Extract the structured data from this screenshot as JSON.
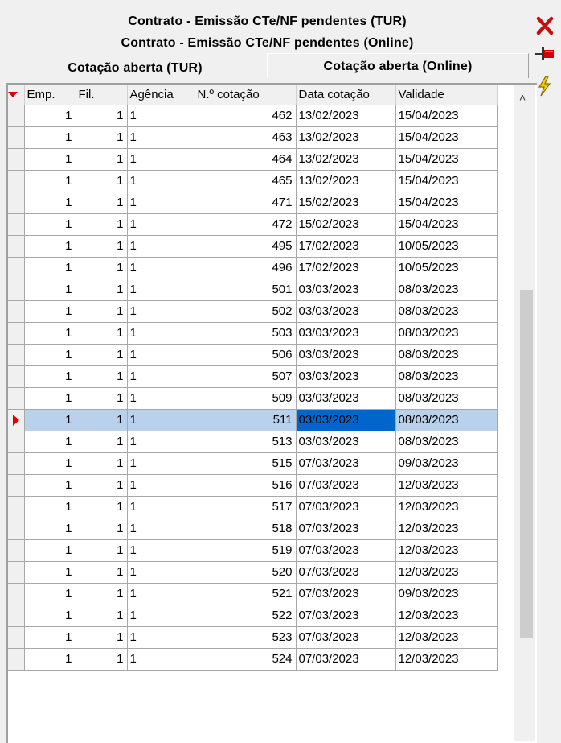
{
  "tabs": [
    {
      "label": "Contrato - Emissão CTe/NF pendentes (TUR)"
    },
    {
      "label": "Contrato - Emissão CTe/NF pendentes (Online)"
    },
    {
      "label": "Cotação aberta (TUR)"
    },
    {
      "label": "Cotação aberta (Online)",
      "active": true
    }
  ],
  "toolbar": {
    "close_icon": "close-icon",
    "pin_icon": "pin-icon",
    "bolt_icon": "lightning-icon"
  },
  "grid": {
    "columns": [
      "Emp.",
      "Fil.",
      "Agência",
      "N.º cotação",
      "Data cotação",
      "Validade"
    ],
    "selected_row": 14,
    "rows": [
      {
        "emp": "1",
        "fil": "1",
        "agencia": "1",
        "cotacao": "462",
        "data": "13/02/2023",
        "validade": "15/04/2023"
      },
      {
        "emp": "1",
        "fil": "1",
        "agencia": "1",
        "cotacao": "463",
        "data": "13/02/2023",
        "validade": "15/04/2023"
      },
      {
        "emp": "1",
        "fil": "1",
        "agencia": "1",
        "cotacao": "464",
        "data": "13/02/2023",
        "validade": "15/04/2023"
      },
      {
        "emp": "1",
        "fil": "1",
        "agencia": "1",
        "cotacao": "465",
        "data": "13/02/2023",
        "validade": "15/04/2023"
      },
      {
        "emp": "1",
        "fil": "1",
        "agencia": "1",
        "cotacao": "471",
        "data": "15/02/2023",
        "validade": "15/04/2023"
      },
      {
        "emp": "1",
        "fil": "1",
        "agencia": "1",
        "cotacao": "472",
        "data": "15/02/2023",
        "validade": "15/04/2023"
      },
      {
        "emp": "1",
        "fil": "1",
        "agencia": "1",
        "cotacao": "495",
        "data": "17/02/2023",
        "validade": "10/05/2023"
      },
      {
        "emp": "1",
        "fil": "1",
        "agencia": "1",
        "cotacao": "496",
        "data": "17/02/2023",
        "validade": "10/05/2023"
      },
      {
        "emp": "1",
        "fil": "1",
        "agencia": "1",
        "cotacao": "501",
        "data": "03/03/2023",
        "validade": "08/03/2023"
      },
      {
        "emp": "1",
        "fil": "1",
        "agencia": "1",
        "cotacao": "502",
        "data": "03/03/2023",
        "validade": "08/03/2023"
      },
      {
        "emp": "1",
        "fil": "1",
        "agencia": "1",
        "cotacao": "503",
        "data": "03/03/2023",
        "validade": "08/03/2023"
      },
      {
        "emp": "1",
        "fil": "1",
        "agencia": "1",
        "cotacao": "506",
        "data": "03/03/2023",
        "validade": "08/03/2023"
      },
      {
        "emp": "1",
        "fil": "1",
        "agencia": "1",
        "cotacao": "507",
        "data": "03/03/2023",
        "validade": "08/03/2023"
      },
      {
        "emp": "1",
        "fil": "1",
        "agencia": "1",
        "cotacao": "509",
        "data": "03/03/2023",
        "validade": "08/03/2023"
      },
      {
        "emp": "1",
        "fil": "1",
        "agencia": "1",
        "cotacao": "511",
        "data": "03/03/2023",
        "validade": "08/03/2023"
      },
      {
        "emp": "1",
        "fil": "1",
        "agencia": "1",
        "cotacao": "513",
        "data": "03/03/2023",
        "validade": "08/03/2023"
      },
      {
        "emp": "1",
        "fil": "1",
        "agencia": "1",
        "cotacao": "515",
        "data": "07/03/2023",
        "validade": "09/03/2023"
      },
      {
        "emp": "1",
        "fil": "1",
        "agencia": "1",
        "cotacao": "516",
        "data": "07/03/2023",
        "validade": "12/03/2023"
      },
      {
        "emp": "1",
        "fil": "1",
        "agencia": "1",
        "cotacao": "517",
        "data": "07/03/2023",
        "validade": "12/03/2023"
      },
      {
        "emp": "1",
        "fil": "1",
        "agencia": "1",
        "cotacao": "518",
        "data": "07/03/2023",
        "validade": "12/03/2023"
      },
      {
        "emp": "1",
        "fil": "1",
        "agencia": "1",
        "cotacao": "519",
        "data": "07/03/2023",
        "validade": "12/03/2023"
      },
      {
        "emp": "1",
        "fil": "1",
        "agencia": "1",
        "cotacao": "520",
        "data": "07/03/2023",
        "validade": "12/03/2023"
      },
      {
        "emp": "1",
        "fil": "1",
        "agencia": "1",
        "cotacao": "521",
        "data": "07/03/2023",
        "validade": "09/03/2023"
      },
      {
        "emp": "1",
        "fil": "1",
        "agencia": "1",
        "cotacao": "522",
        "data": "07/03/2023",
        "validade": "12/03/2023"
      },
      {
        "emp": "1",
        "fil": "1",
        "agencia": "1",
        "cotacao": "523",
        "data": "07/03/2023",
        "validade": "12/03/2023"
      },
      {
        "emp": "1",
        "fil": "1",
        "agencia": "1",
        "cotacao": "524",
        "data": "07/03/2023",
        "validade": "12/03/2023"
      }
    ]
  },
  "colors": {
    "indicator_red": "#e00000",
    "selected_row": "#b9d1ea",
    "selected_cell": "#0066cc"
  }
}
